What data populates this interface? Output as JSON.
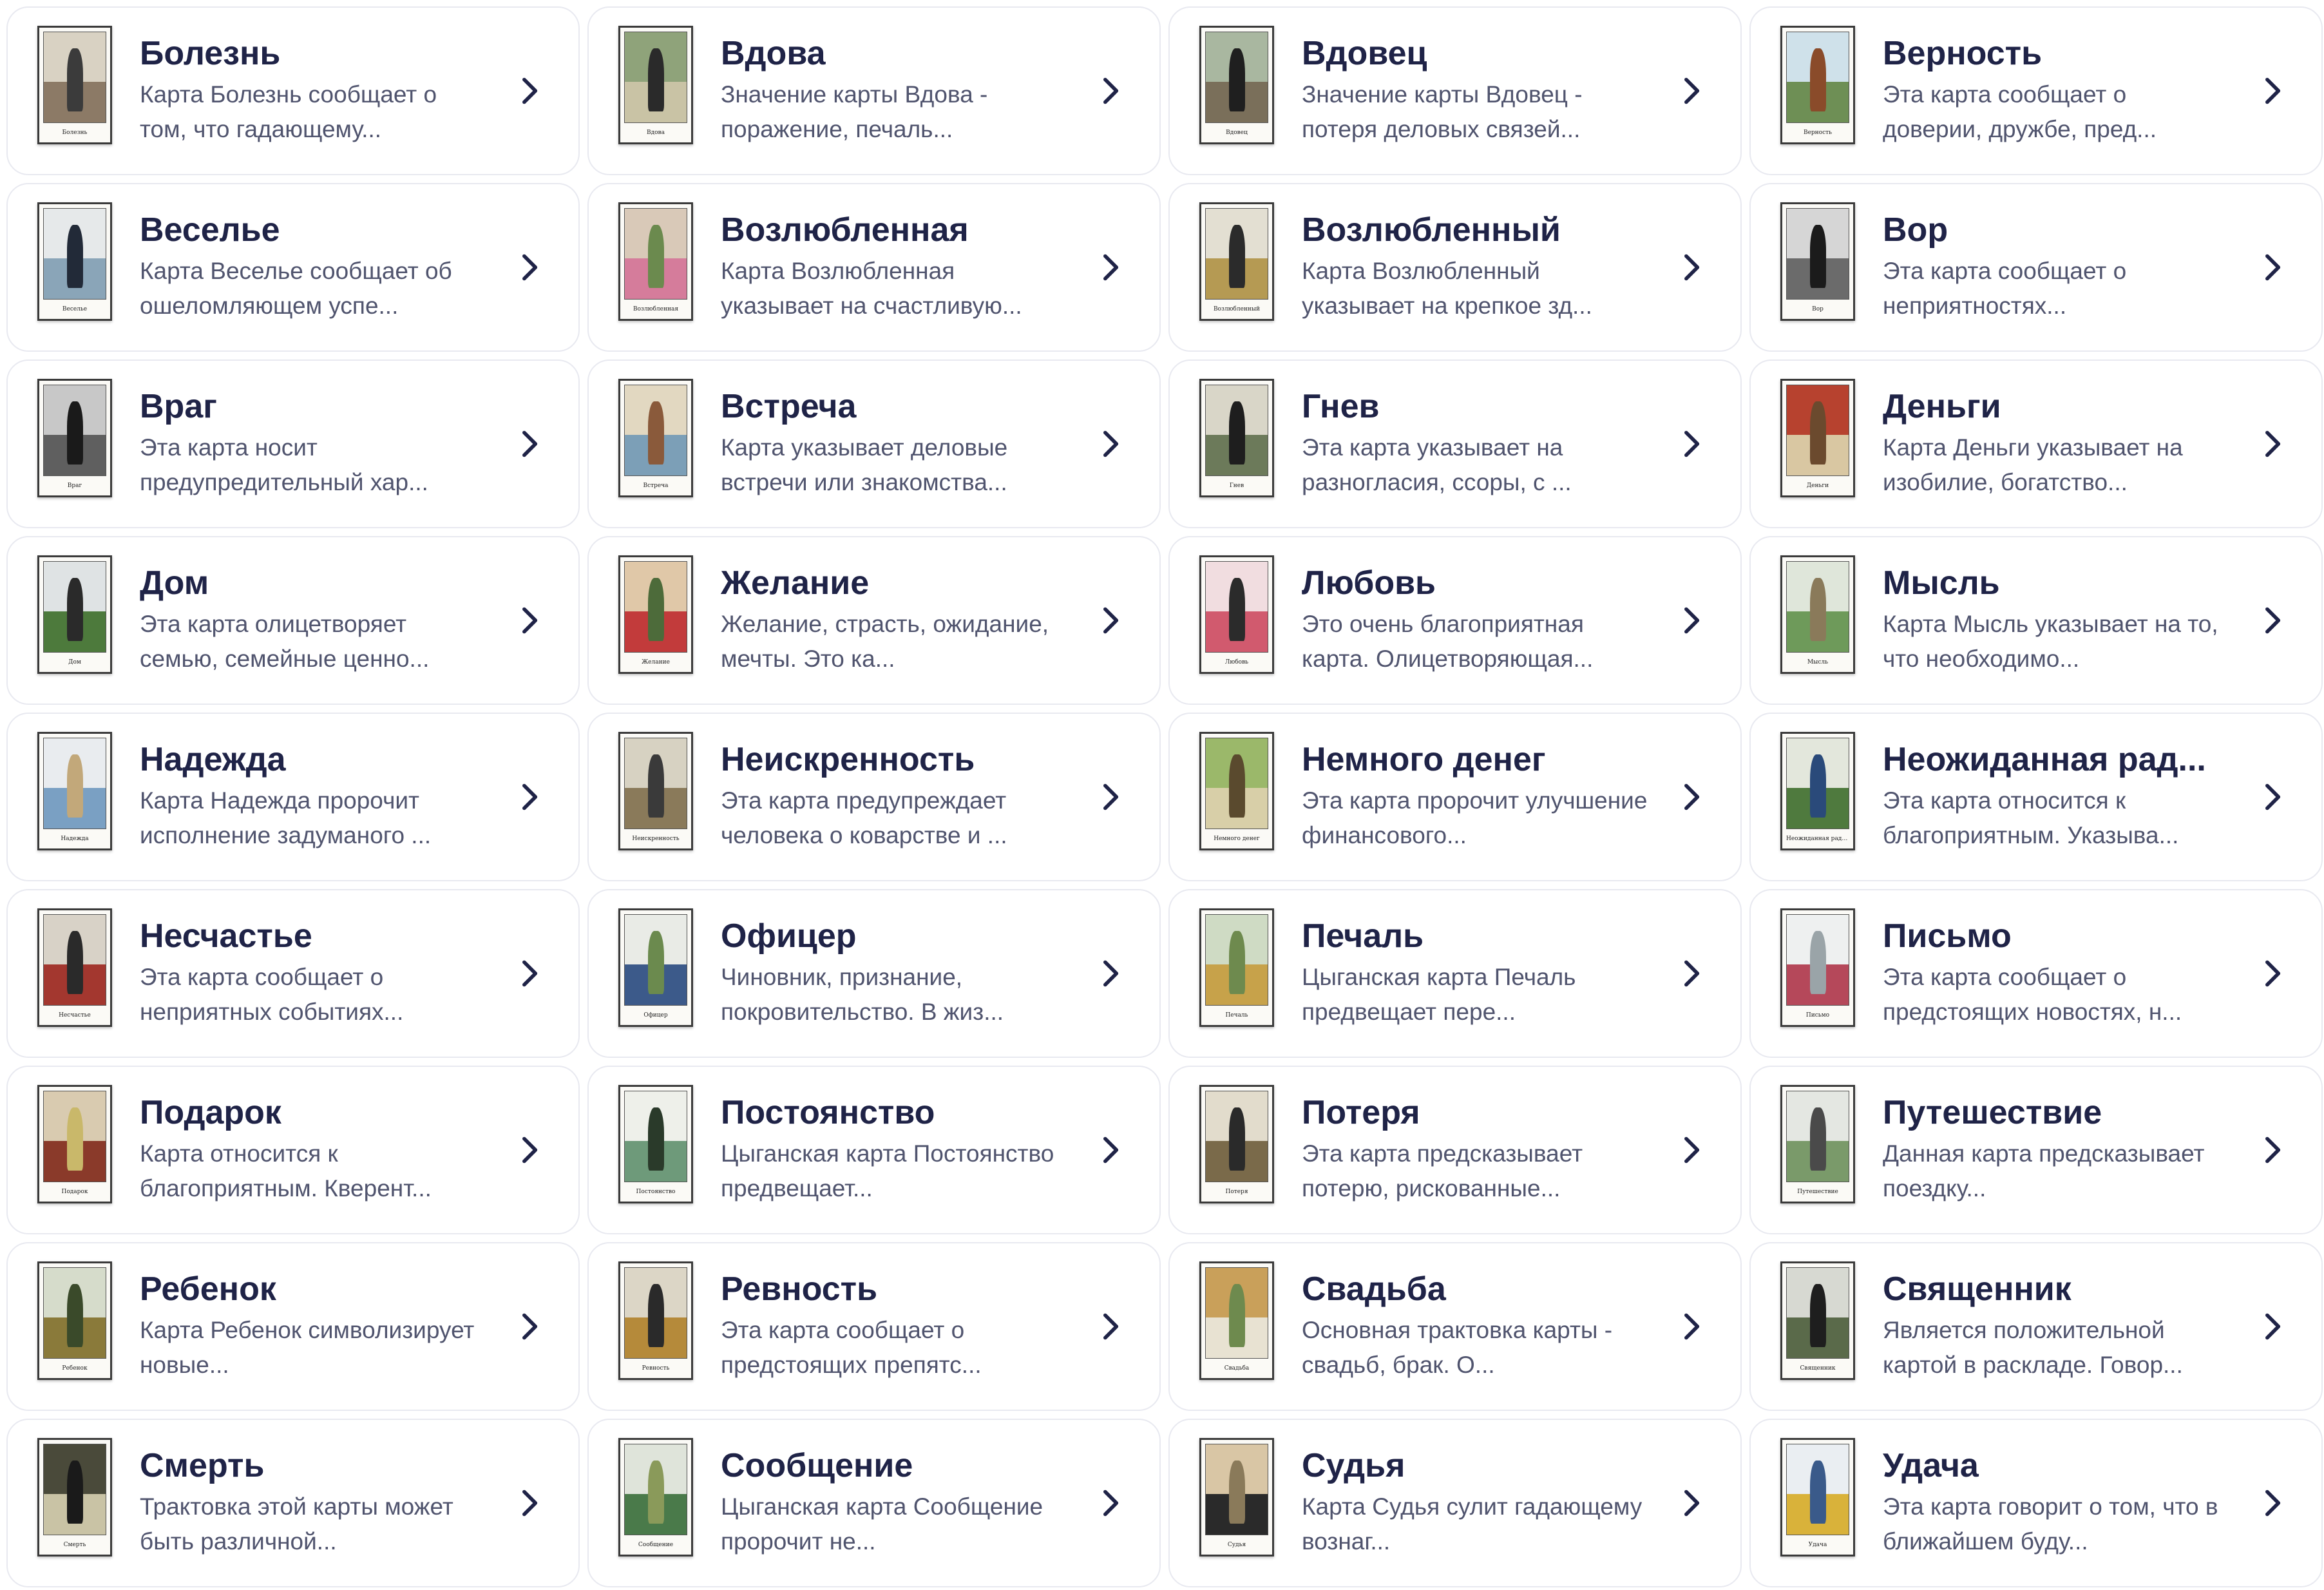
{
  "colors": {
    "title": "#1f2347",
    "description": "#50546e",
    "card_border": "#e8e9f0",
    "chevron": "#1f2347"
  },
  "cards": [
    {
      "title": "Болезнь",
      "description": "Карта Болезнь сообщает о том, что гадающему...",
      "caption": "Болезнь",
      "icon": "chevron-right-icon",
      "palette": [
        "#d9d2c3",
        "#8c7a66",
        "#3b3b3b"
      ]
    },
    {
      "title": "Вдова",
      "description": "Значение карты Вдова - поражение, печаль...",
      "caption": "Вдова",
      "icon": "chevron-right-icon",
      "palette": [
        "#8fa37a",
        "#c9c3a5",
        "#2a2a2a"
      ]
    },
    {
      "title": "Вдовец",
      "description": "Значение карты Вдовец - потеря деловых связей...",
      "caption": "Вдовец",
      "icon": "chevron-right-icon",
      "palette": [
        "#a9b7a0",
        "#7a6f5a",
        "#1f1f1f"
      ]
    },
    {
      "title": "Верность",
      "description": "Эта карта сообщает о доверии, дружбе, пред...",
      "caption": "Верность",
      "icon": "chevron-right-icon",
      "palette": [
        "#cfe1ea",
        "#6e8f55",
        "#8a4b2a"
      ]
    },
    {
      "title": "Веселье",
      "description": "Карта Веселье сообщает об ошеломляющем успе...",
      "caption": "Веселье",
      "icon": "chevron-right-icon",
      "palette": [
        "#e6e9ea",
        "#8aa5b8",
        "#222a38"
      ]
    },
    {
      "title": "Возлюбленная",
      "description": "Карта Возлюбленная указывает на счастливую...",
      "caption": "Возлюбленная",
      "icon": "chevron-right-icon",
      "palette": [
        "#d9c9b8",
        "#d57c9b",
        "#6b8a4e"
      ]
    },
    {
      "title": "Возлюбленный",
      "description": "Карта Возлюбленный указывает на крепкое зд...",
      "caption": "Возлюбленный",
      "icon": "chevron-right-icon",
      "palette": [
        "#e3dfd2",
        "#b59a53",
        "#2b2b2b"
      ]
    },
    {
      "title": "Вор",
      "description": "Эта карта сообщает о неприятностях...",
      "caption": "Вор",
      "icon": "chevron-right-icon",
      "palette": [
        "#d6d6d6",
        "#6b6b6b",
        "#1b1b1b"
      ]
    },
    {
      "title": "Враг",
      "description": "Эта карта носит предупредительный хар...",
      "caption": "Враг",
      "icon": "chevron-right-icon",
      "palette": [
        "#c8c8c8",
        "#5f5f5f",
        "#1a1a1a"
      ]
    },
    {
      "title": "Встреча",
      "description": "Карта указывает деловые встречи или знакомства...",
      "caption": "Встреча",
      "icon": "chevron-right-icon",
      "palette": [
        "#e2d8c1",
        "#7c9fb7",
        "#8a5a3b"
      ]
    },
    {
      "title": "Гнев",
      "description": "Эта карта указывает на разногласия, ссоры, с ...",
      "caption": "Гнев",
      "icon": "chevron-right-icon",
      "palette": [
        "#d9d6c8",
        "#6c7a5a",
        "#1e1e1e"
      ]
    },
    {
      "title": "Деньги",
      "description": "Карта Деньги указывает на изобилие, богатство...",
      "caption": "Деньги",
      "icon": "chevron-right-icon",
      "palette": [
        "#b7422f",
        "#d9c7a2",
        "#6b4a2e"
      ]
    },
    {
      "title": "Дом",
      "description": "Эта карта олицетворяет семью, семейные ценно...",
      "caption": "Дом",
      "icon": "chevron-right-icon",
      "palette": [
        "#dfe3e4",
        "#4d7a3c",
        "#2a2a2a"
      ]
    },
    {
      "title": "Желание",
      "description": "Желание, страсть, ожидание, мечты. Это ка...",
      "caption": "Желание",
      "icon": "chevron-right-icon",
      "palette": [
        "#e0c8a8",
        "#c23b3b",
        "#4d6b3a"
      ]
    },
    {
      "title": "Любовь",
      "description": "Это очень благоприятная карта. Олицетворяющая...",
      "caption": "Любовь",
      "icon": "chevron-right-icon",
      "palette": [
        "#f1dde0",
        "#d15a6e",
        "#2b2b2b"
      ]
    },
    {
      "title": "Мысль",
      "description": "Карта Мысль указывает на то, что необходимо...",
      "caption": "Мысль",
      "icon": "chevron-right-icon",
      "palette": [
        "#dfe6da",
        "#6e9a5a",
        "#8a7a5a"
      ]
    },
    {
      "title": "Надежда",
      "description": "Карта Надежда пророчит исполнение задуманого ...",
      "caption": "Надежда",
      "icon": "chevron-right-icon",
      "palette": [
        "#e9ecef",
        "#7aa0c3",
        "#c2a87a"
      ]
    },
    {
      "title": "Неискренность",
      "description": "Эта карта предупреждает человека о коварстве и ...",
      "caption": "Неискренность",
      "icon": "chevron-right-icon",
      "palette": [
        "#d7d2c2",
        "#8a7a5a",
        "#3a3a3a"
      ]
    },
    {
      "title": "Немного денег",
      "description": "Эта карта пророчит улучшение финансового...",
      "caption": "Немного денег",
      "icon": "chevron-right-icon",
      "palette": [
        "#9bb86a",
        "#d8cfa8",
        "#5a4a2e"
      ]
    },
    {
      "title": "Неожиданная рад...",
      "description": "Эта карта относится к благоприятным. Указыва...",
      "caption": "Неожиданная радость",
      "icon": "chevron-right-icon",
      "palette": [
        "#e3e7dc",
        "#4f7a3e",
        "#2a4a7a"
      ]
    },
    {
      "title": "Несчастье",
      "description": "Эта карта сообщает о неприятных событиях...",
      "caption": "Несчастье",
      "icon": "chevron-right-icon",
      "palette": [
        "#d8d2c7",
        "#a3372f",
        "#2a2a2a"
      ]
    },
    {
      "title": "Офицер",
      "description": "Чиновник, признание, покровительство. В жиз...",
      "caption": "Офицер",
      "icon": "chevron-right-icon",
      "palette": [
        "#e9ebe6",
        "#3c5a8a",
        "#6b8a4e"
      ]
    },
    {
      "title": "Печаль",
      "description": "Цыганская карта Печаль предвещает пере...",
      "caption": "Печаль",
      "icon": "chevron-right-icon",
      "palette": [
        "#cfdbc4",
        "#c7a24a",
        "#6e8a4e"
      ]
    },
    {
      "title": "Письмо",
      "description": "Эта карта сообщает о предстоящих новостях, н...",
      "caption": "Письмо",
      "icon": "chevron-right-icon",
      "palette": [
        "#eef0f0",
        "#b5485a",
        "#9aa4a8"
      ]
    },
    {
      "title": "Подарок",
      "description": "Карта относится к благоприятным. Кверент...",
      "caption": "Подарок",
      "icon": "chevron-right-icon",
      "palette": [
        "#d9cbb0",
        "#8a3a2a",
        "#c9b86a"
      ]
    },
    {
      "title": "Постоянство",
      "description": "Цыганская карта Постоянство предвещает...",
      "caption": "Постоянство",
      "icon": "chevron-right-icon",
      "palette": [
        "#eef0ea",
        "#6e9a7a",
        "#2a3a2a"
      ]
    },
    {
      "title": "Потеря",
      "description": "Эта карта предсказывает потерю, рискованные...",
      "caption": "Потеря",
      "icon": "chevron-right-icon",
      "palette": [
        "#e2dccc",
        "#7a6a4a",
        "#2a2a2a"
      ]
    },
    {
      "title": "Путешествие",
      "description": "Данная карта предсказывает поездку...",
      "caption": "Путешествие",
      "icon": "chevron-right-icon",
      "palette": [
        "#e4e7e2",
        "#7a9a6a",
        "#4a4a4a"
      ]
    },
    {
      "title": "Ребенок",
      "description": "Карта Ребенок символизирует новые...",
      "caption": "Ребенок",
      "icon": "chevron-right-icon",
      "palette": [
        "#d6dccb",
        "#8a7a3a",
        "#3a4a2a"
      ]
    },
    {
      "title": "Ревность",
      "description": "Эта карта сообщает о предстоящих препятс...",
      "caption": "Ревность",
      "icon": "chevron-right-icon",
      "palette": [
        "#dcd6c6",
        "#b58a3a",
        "#2a2a2a"
      ]
    },
    {
      "title": "Свадьба",
      "description": "Основная трактовка карты - свадьб, брак. О...",
      "caption": "Свадьба",
      "icon": "chevron-right-icon",
      "palette": [
        "#c9a05a",
        "#e8e2d2",
        "#6e8a4e"
      ]
    },
    {
      "title": "Священник",
      "description": "Является положительной картой в раскладе. Говор...",
      "caption": "Священник",
      "icon": "chevron-right-icon",
      "palette": [
        "#d7d9d2",
        "#5a6a4a",
        "#1e1e1e"
      ]
    },
    {
      "title": "Смерть",
      "description": "Трактовка этой карты может быть различной...",
      "caption": "Смерть",
      "icon": "chevron-right-icon",
      "palette": [
        "#4a4a3a",
        "#c9c3a5",
        "#1a1a1a"
      ]
    },
    {
      "title": "Сообщение",
      "description": "Цыганская карта Сообщение пророчит не...",
      "caption": "Сообщение",
      "icon": "chevron-right-icon",
      "palette": [
        "#dfe4da",
        "#4a7a4a",
        "#8a9a5a"
      ]
    },
    {
      "title": "Судья",
      "description": "Карта Судья сулит гадающему вознаг...",
      "caption": "Судья",
      "icon": "chevron-right-icon",
      "palette": [
        "#d9c6a5",
        "#2a2a2a",
        "#8a7a5a"
      ]
    },
    {
      "title": "Удача",
      "description": "Эта карта говорит о том, что в ближайшем буду...",
      "caption": "Удача",
      "icon": "chevron-right-icon",
      "palette": [
        "#eaeef2",
        "#d9b23a",
        "#3a5a8a"
      ]
    }
  ]
}
